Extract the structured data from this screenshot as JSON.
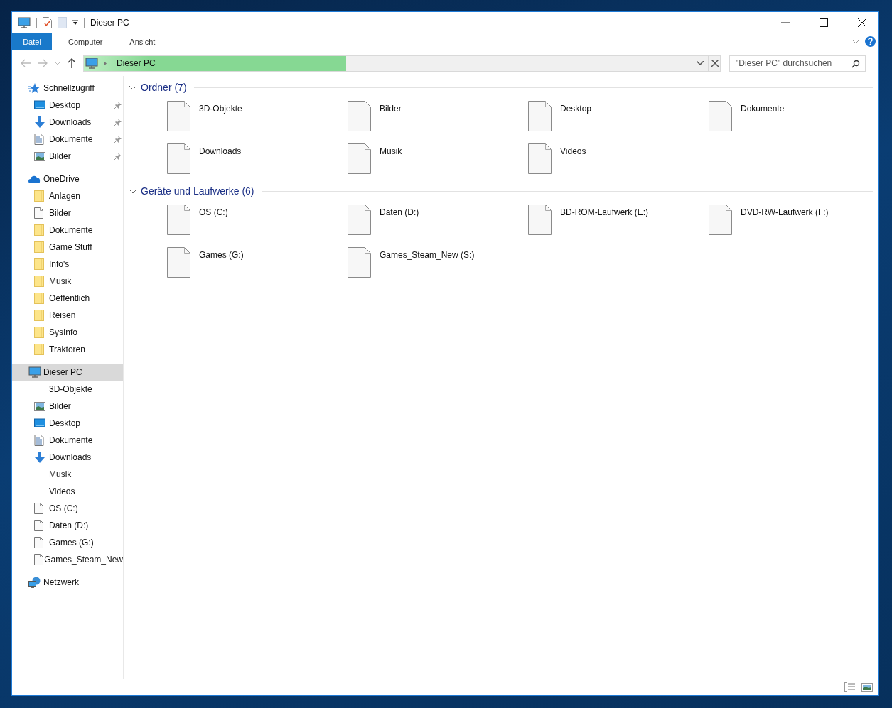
{
  "window": {
    "title": "Dieser PC"
  },
  "ribbon": {
    "tabs": [
      {
        "label": "Datei",
        "kind": "file"
      },
      {
        "label": "Computer",
        "kind": "tab"
      },
      {
        "label": "Ansicht",
        "kind": "tab"
      }
    ]
  },
  "address_bar": {
    "path": "Dieser PC",
    "level": 0.42
  },
  "search": {
    "placeholder": "\"Dieser PC\" durchsuchen"
  },
  "sidebar": {
    "groups": [
      {
        "label": "Schnellzugriff",
        "kind": "star",
        "selected": false,
        "children": [
          {
            "label": "Desktop",
            "kind": "desktop",
            "pinned": true
          },
          {
            "label": "Downloads",
            "kind": "download",
            "pinned": true
          },
          {
            "label": "Dokumente",
            "kind": "document",
            "pinned": true
          },
          {
            "label": "Bilder",
            "kind": "picture",
            "pinned": true
          }
        ]
      },
      {
        "label": "OneDrive",
        "kind": "cloud",
        "selected": false,
        "children": [
          {
            "label": "Anlagen",
            "kind": "folder",
            "pinned": false
          },
          {
            "label": "Bilder",
            "kind": "file",
            "pinned": false
          },
          {
            "label": "Dokumente",
            "kind": "folder",
            "pinned": false
          },
          {
            "label": "Game Stuff",
            "kind": "folder",
            "pinned": false
          },
          {
            "label": "Info's",
            "kind": "folder",
            "pinned": false
          },
          {
            "label": "Musik",
            "kind": "folder",
            "pinned": false
          },
          {
            "label": "Oeffentlich",
            "kind": "folder",
            "pinned": false
          },
          {
            "label": "Reisen",
            "kind": "folder",
            "pinned": false
          },
          {
            "label": "SysInfo",
            "kind": "folder",
            "pinned": false
          },
          {
            "label": "Traktoren",
            "kind": "folder",
            "pinned": false
          }
        ]
      },
      {
        "label": "Dieser PC",
        "kind": "pc",
        "selected": true,
        "children": [
          {
            "label": "3D-Objekte",
            "kind": "none",
            "pinned": false
          },
          {
            "label": "Bilder",
            "kind": "picture",
            "pinned": false
          },
          {
            "label": "Desktop",
            "kind": "desktop",
            "pinned": false
          },
          {
            "label": "Dokumente",
            "kind": "document",
            "pinned": false
          },
          {
            "label": "Downloads",
            "kind": "download",
            "pinned": false
          },
          {
            "label": "Musik",
            "kind": "none",
            "pinned": false
          },
          {
            "label": "Videos",
            "kind": "none",
            "pinned": false
          },
          {
            "label": "OS (C:)",
            "kind": "file",
            "pinned": false
          },
          {
            "label": "Daten (D:)",
            "kind": "file",
            "pinned": false
          },
          {
            "label": "Games (G:)",
            "kind": "file",
            "pinned": false
          },
          {
            "label": "Games_Steam_New",
            "kind": "file",
            "pinned": false
          }
        ]
      },
      {
        "label": "Netzwerk",
        "kind": "network",
        "selected": false
      }
    ]
  },
  "sections": [
    {
      "title": "Ordner (7)",
      "expanded": true,
      "items": [
        "3D-Objekte",
        "Bilder",
        "Desktop",
        "Dokumente",
        "Downloads",
        "Musik",
        "Videos"
      ]
    },
    {
      "title": "Geräte und Laufwerke (6)",
      "expanded": true,
      "items": [
        "OS (C:)",
        "Daten (D:)",
        "BD-ROM-Laufwerk (E:)",
        "DVD-RW-Laufwerk (F:)",
        "Games (G:)",
        "Games_Steam_New (S:)"
      ]
    }
  ]
}
